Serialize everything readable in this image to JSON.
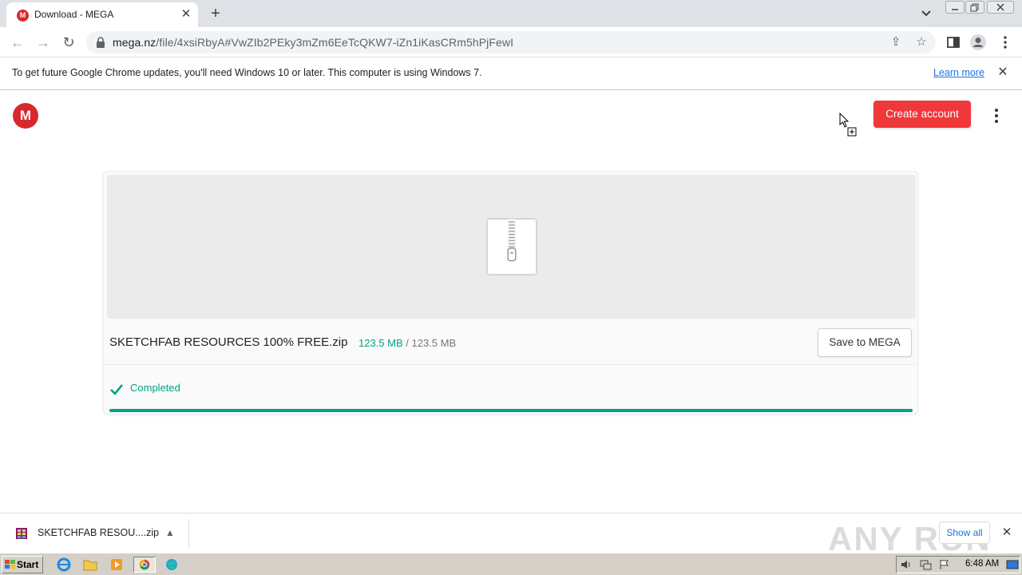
{
  "browser": {
    "tab_title": "Download - MEGA",
    "url_host": "mega.nz",
    "url_path": "/file/4xsiRbyA#VwZIb2PEky3mZm6EeTcQKW7-iZn1iKasCRm5hPjFewI",
    "tab_favicon_letter": "M"
  },
  "infobar": {
    "message": "To get future Google Chrome updates, you'll need Windows 10 or later. This computer is using Windows 7.",
    "link": "Learn more"
  },
  "mega": {
    "logo_letter": "M",
    "create_account_label": "Create account",
    "file_name": "SKETCHFAB RESOURCES 100% FREE.zip",
    "downloaded": "123.5 MB",
    "size_separator": " / ",
    "total": "123.5 MB",
    "save_label": "Save to MEGA",
    "status": "Completed",
    "progress_percent": 100,
    "accent_color": "#00a382",
    "brand_color": "#d9272e"
  },
  "download_shelf": {
    "file_name": "SKETCHFAB RESOU....zip",
    "show_all_label": "Show all",
    "watermark": "ANY RUN"
  },
  "taskbar": {
    "start_label": "Start",
    "clock": "6:48 AM"
  }
}
